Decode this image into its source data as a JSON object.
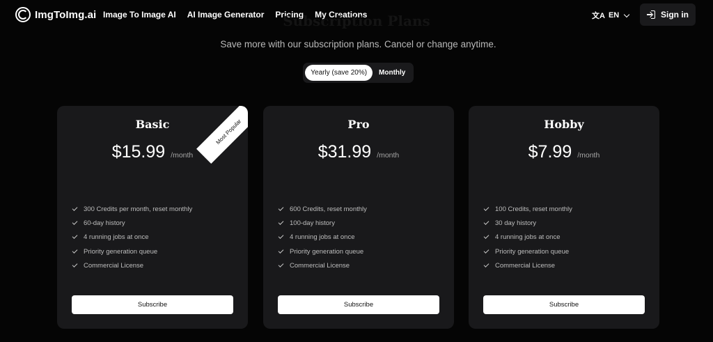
{
  "nav": {
    "logo_text": "ImgToImg.ai",
    "links": [
      "Image To Image AI",
      "AI Image Generator",
      "Pricing",
      "My Creations"
    ],
    "language": "EN",
    "signin_label": "Sign in"
  },
  "header": {
    "ghost_title": "Subscription Plans",
    "subtitle": "Save more with our subscription plans. Cancel or change anytime."
  },
  "billing_toggle": {
    "yearly_label": "Yearly (save 20%)",
    "monthly_label": "Monthly",
    "selected": "yearly"
  },
  "plans": [
    {
      "name": "Basic",
      "price": "$15.99",
      "period": "/month",
      "badge": "Most Popular",
      "features": [
        "300 Credits per month, reset monthly",
        "60-day history",
        "4 running jobs at once",
        "Priority generation queue",
        "Commercial License"
      ],
      "cta": "Subscribe"
    },
    {
      "name": "Pro",
      "price": "$31.99",
      "period": "/month",
      "features": [
        "600 Credits, reset monthly",
        "100-day history",
        "4 running jobs at once",
        "Priority generation queue",
        "Commercial License"
      ],
      "cta": "Subscribe"
    },
    {
      "name": "Hobby",
      "price": "$7.99",
      "period": "/month",
      "features": [
        "100 Credits, reset monthly",
        "30 day history",
        "4 running jobs at once",
        "Priority generation queue",
        "Commercial License"
      ],
      "cta": "Subscribe"
    }
  ],
  "colors": {
    "background": "#050505",
    "card": "#19191b",
    "text_primary": "#ffffff",
    "text_muted": "#bdbdbd"
  }
}
